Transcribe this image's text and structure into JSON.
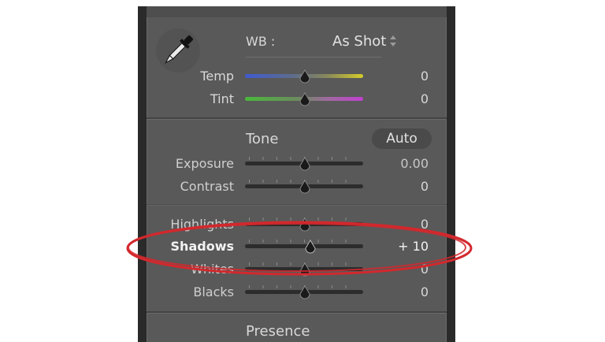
{
  "white_balance": {
    "wb_label": "WB :",
    "wb_value": "As Shot",
    "temp": {
      "label": "Temp",
      "value": "0"
    },
    "tint": {
      "label": "Tint",
      "value": "0"
    }
  },
  "tone": {
    "title": "Tone",
    "auto_label": "Auto",
    "exposure": {
      "label": "Exposure",
      "value": "0.00"
    },
    "contrast": {
      "label": "Contrast",
      "value": "0"
    }
  },
  "tonal_ranges": {
    "highlights": {
      "label": "Highlights",
      "value": "0"
    },
    "shadows": {
      "label": "Shadows",
      "value": "+ 10"
    },
    "whites": {
      "label": "Whites",
      "value": "0"
    },
    "blacks": {
      "label": "Blacks",
      "value": "0"
    }
  },
  "presence": {
    "title": "Presence"
  },
  "colors": {
    "annotation_ellipse": "#d3282d",
    "panel_bg": "#595959",
    "frame_bg": "#2a2a2a"
  },
  "icons": [
    "eyedropper-icon",
    "updown-arrows-icon",
    "slider-thumb-icon"
  ]
}
